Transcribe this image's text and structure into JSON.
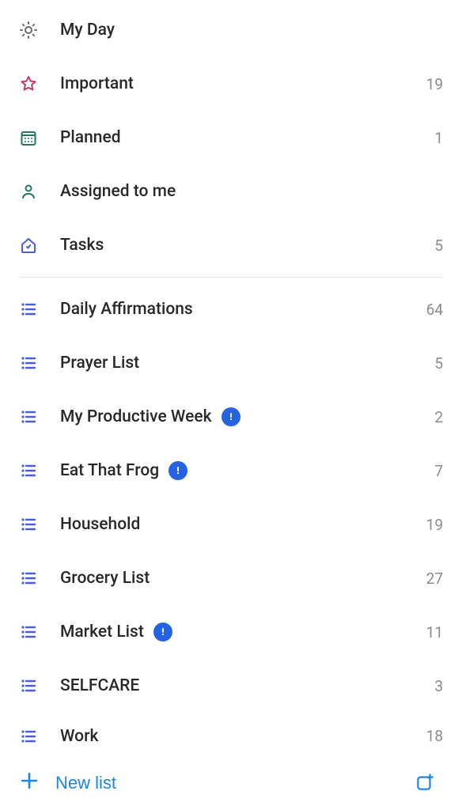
{
  "smart_lists": [
    {
      "id": "my-day",
      "label": "My Day",
      "count": null,
      "icon": "sun",
      "color": "#6b6b6b"
    },
    {
      "id": "important",
      "label": "Important",
      "count": 19,
      "icon": "star",
      "color": "#c23b67"
    },
    {
      "id": "planned",
      "label": "Planned",
      "count": 1,
      "icon": "calendar",
      "color": "#1f7a58"
    },
    {
      "id": "assigned",
      "label": "Assigned to me",
      "count": null,
      "icon": "person",
      "color": "#1f7a58"
    },
    {
      "id": "tasks",
      "label": "Tasks",
      "count": 5,
      "icon": "home",
      "color": "#4b5fd1"
    }
  ],
  "user_lists": [
    {
      "id": "affirm",
      "label": "Daily Affirmations",
      "count": 64,
      "shared": false
    },
    {
      "id": "prayer",
      "label": "Prayer List",
      "count": 5,
      "shared": false
    },
    {
      "id": "prodweek",
      "label": "My Productive Week",
      "count": 2,
      "shared": true
    },
    {
      "id": "frog",
      "label": "Eat That Frog",
      "count": 7,
      "shared": true
    },
    {
      "id": "household",
      "label": "Household",
      "count": 19,
      "shared": false
    },
    {
      "id": "grocery",
      "label": "Grocery List",
      "count": 27,
      "shared": false
    },
    {
      "id": "market",
      "label": "Market List",
      "count": 11,
      "shared": true
    },
    {
      "id": "selfcare",
      "label": "SELFCARE",
      "count": 3,
      "shared": false
    },
    {
      "id": "work",
      "label": "Work",
      "count": 18,
      "shared": false
    }
  ],
  "bottom": {
    "new_list_label": "New list"
  },
  "colors": {
    "accent": "#1985e6",
    "list_icon": "#4b5fd1",
    "count": "#8b8b8b",
    "share_bg": "#2563e3"
  }
}
